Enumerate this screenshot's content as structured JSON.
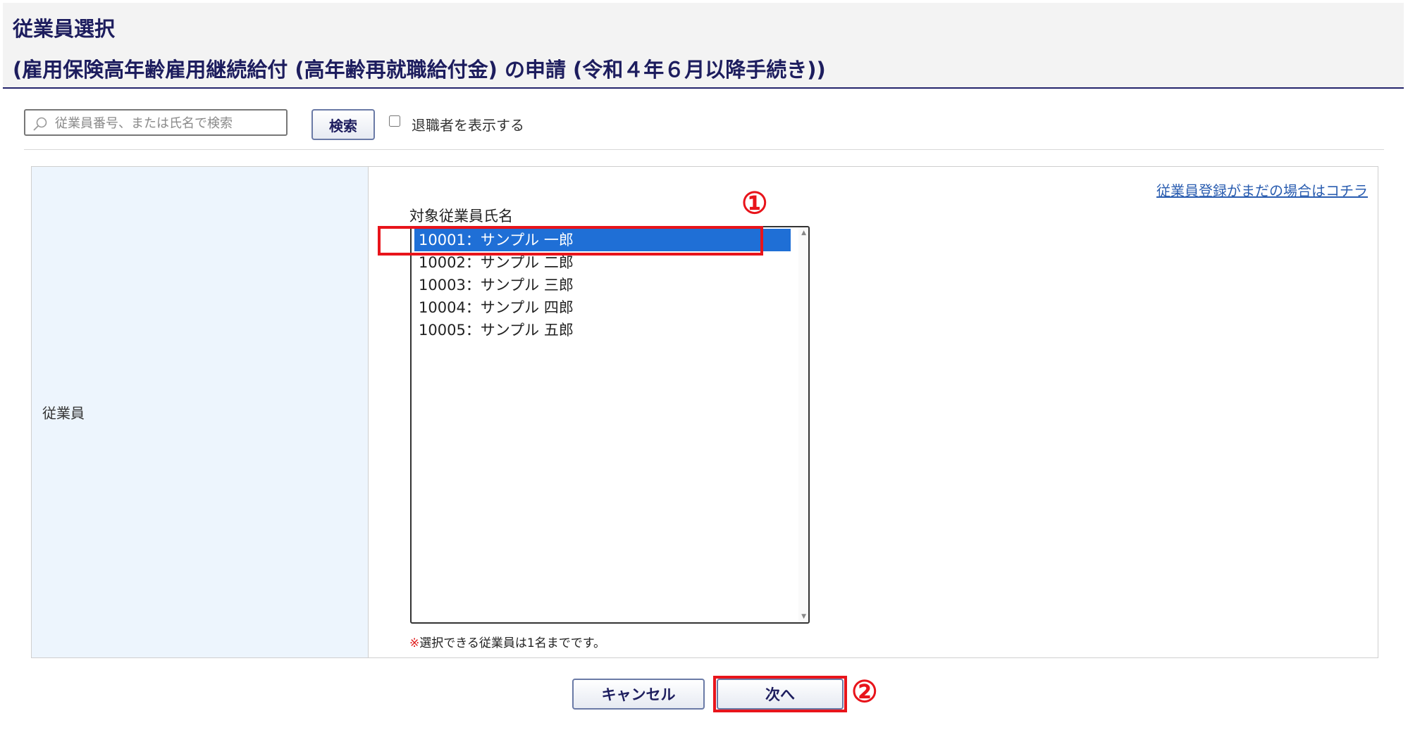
{
  "header": {
    "title_line1": "従業員選択",
    "title_line2": "(雇用保険高年齢雇用継続給付 (高年齢再就職給付金) の申請 (令和４年６月以降手続き))"
  },
  "search": {
    "placeholder": "従業員番号、または氏名で検索",
    "button_label": "検索",
    "retired_checkbox_label": "退職者を表示する"
  },
  "form": {
    "field_label": "従業員",
    "register_link": "従業員登録がまだの場合はコチラ",
    "list_label": "対象従業員氏名",
    "employees": [
      "10001：サンプル 一郎",
      "10002：サンプル 二郎",
      "10003：サンプル 三郎",
      "10004：サンプル 四郎",
      "10005：サンプル 五郎"
    ],
    "selected_index": 0,
    "note_mark": "※",
    "note_text": "選択できる従業員は1名までです。"
  },
  "buttons": {
    "cancel_label": "キャンセル",
    "next_label": "次へ"
  },
  "callouts": {
    "one": "①",
    "two": "②"
  },
  "colors": {
    "accent": "#1d1d5e",
    "highlight": "#e8141b",
    "selection": "#1f6fd6",
    "label_bg": "#edf5fd"
  }
}
